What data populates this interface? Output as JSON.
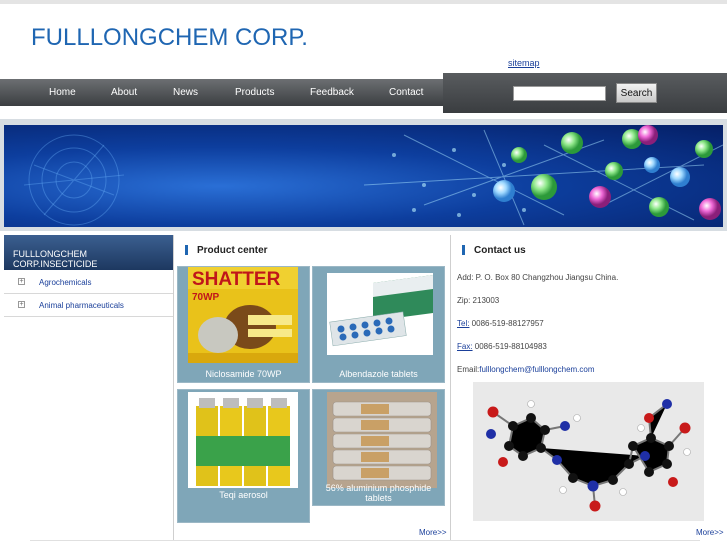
{
  "header": {
    "logo": "FULLLONGCHEM CORP.",
    "sitemap": "sitemap"
  },
  "nav": {
    "items": [
      "Home",
      "About",
      "News",
      "Products",
      "Feedback",
      "Contact"
    ]
  },
  "search": {
    "button": "Search",
    "value": ""
  },
  "sidebar": {
    "title": "FULLLONGCHEM CORP.INSECTICIDE",
    "items": [
      {
        "label": "Agrochemicals"
      },
      {
        "label": "Animal pharmaceuticals"
      }
    ]
  },
  "product_center": {
    "title": "Product center",
    "products": [
      {
        "name": "Niclosamide 70WP",
        "image": "shatter-70wp-package"
      },
      {
        "name": "Albendazole tablets",
        "image": "tablet-blister-box"
      },
      {
        "name": "Teqi aerosol",
        "image": "aerosol-cans"
      },
      {
        "name": "56% aluminium phosphide tablets",
        "image": "phosphide-tubes"
      }
    ],
    "more": "More>>",
    "package_text": {
      "brand": "SHATTER",
      "grade": "70WP"
    }
  },
  "contact": {
    "title": "Contact us",
    "address": "Add: P. O. Box 80 Changzhou  Jiangsu  China.",
    "zip": "Zip: 213003",
    "tel_label": "Tel:",
    "tel": " 0086-519-88127957",
    "fax_label": "Fax:",
    "fax": " 0086-519-88104983",
    "email_label": "Email:",
    "email": "fulllongchem@fulllongchem.com",
    "more": "More>>"
  },
  "colors": {
    "brand": "#1f66b2",
    "nav": "#4a4d50",
    "caption_bg": "#7fa6b8",
    "link": "#1a3f9a"
  }
}
